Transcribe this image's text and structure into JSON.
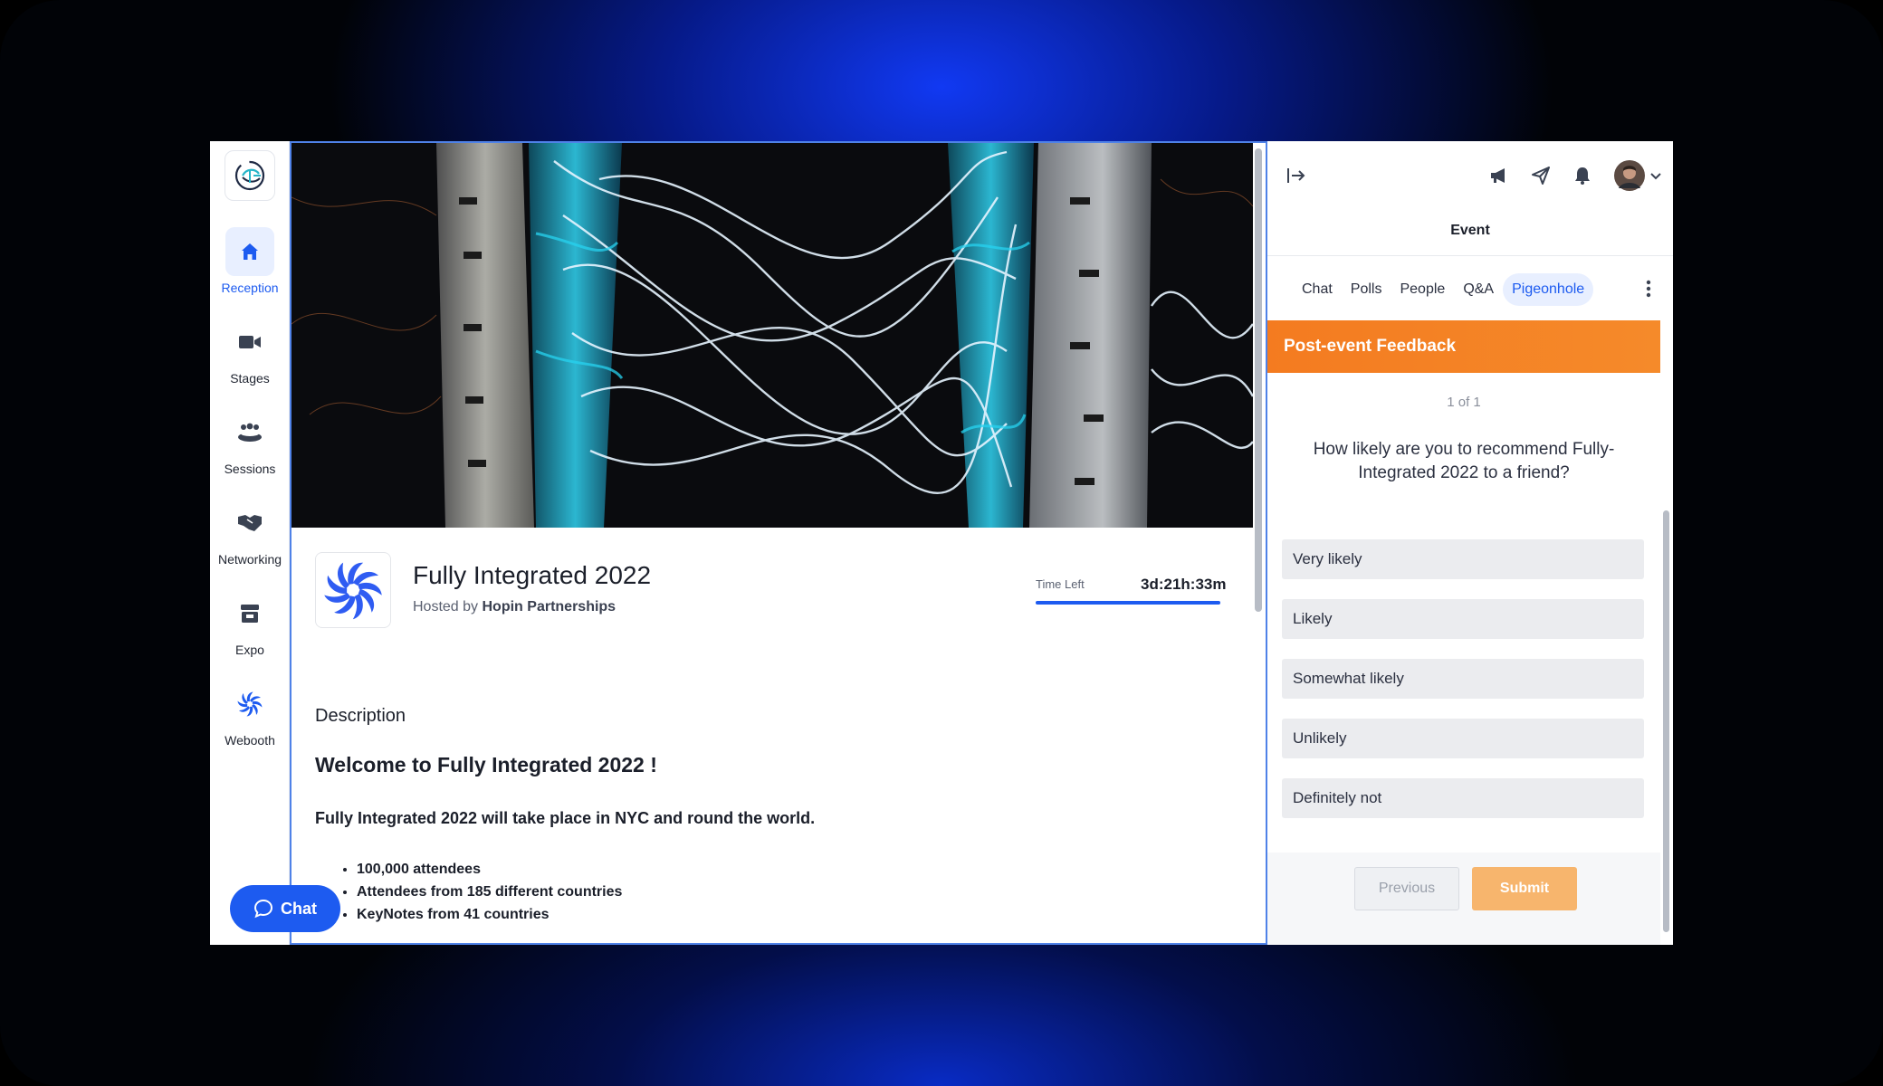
{
  "nav": {
    "items": [
      {
        "label": "Reception",
        "icon": "home-icon"
      },
      {
        "label": "Stages",
        "icon": "video-camera-icon"
      },
      {
        "label": "Sessions",
        "icon": "people-group-icon"
      },
      {
        "label": "Networking",
        "icon": "handshake-icon"
      },
      {
        "label": "Expo",
        "icon": "booth-icon"
      },
      {
        "label": "Webooth",
        "icon": "webooth-icon"
      }
    ]
  },
  "event": {
    "title": "Fully Integrated 2022",
    "hosted_by_prefix": "Hosted by",
    "host": "Hopin Partnerships",
    "time_left_label": "Time Left",
    "time_left_value": "3d:21h:33m",
    "time_left_fraction": 1.0
  },
  "description": {
    "heading": "Description",
    "welcome": "Welcome to Fully Integrated 2022 !",
    "lead": "Fully Integrated 2022 will take place in NYC and round the world.",
    "bullets": [
      "100,000 attendees",
      "Attendees from  185 different countries",
      "KeyNotes from 41 countries"
    ]
  },
  "chat_fab": {
    "label": "Chat"
  },
  "right_panel": {
    "title": "Event",
    "tabs": [
      "Chat",
      "Polls",
      "People",
      "Q&A",
      "Pigeonhole"
    ],
    "active_tab": "Pigeonhole",
    "feedback": {
      "header": "Post-event Feedback",
      "pager": "1 of 1",
      "question": "How likely are you to recommend Fully-Integrated 2022 to a friend?",
      "options": [
        "Very likely",
        "Likely",
        "Somewhat likely",
        "Unlikely",
        "Definitely not"
      ],
      "previous_label": "Previous",
      "submit_label": "Submit"
    }
  },
  "colors": {
    "accent": "#1d5bf0",
    "feedback_header": "#f47b20",
    "submit": "#f7b56d"
  }
}
